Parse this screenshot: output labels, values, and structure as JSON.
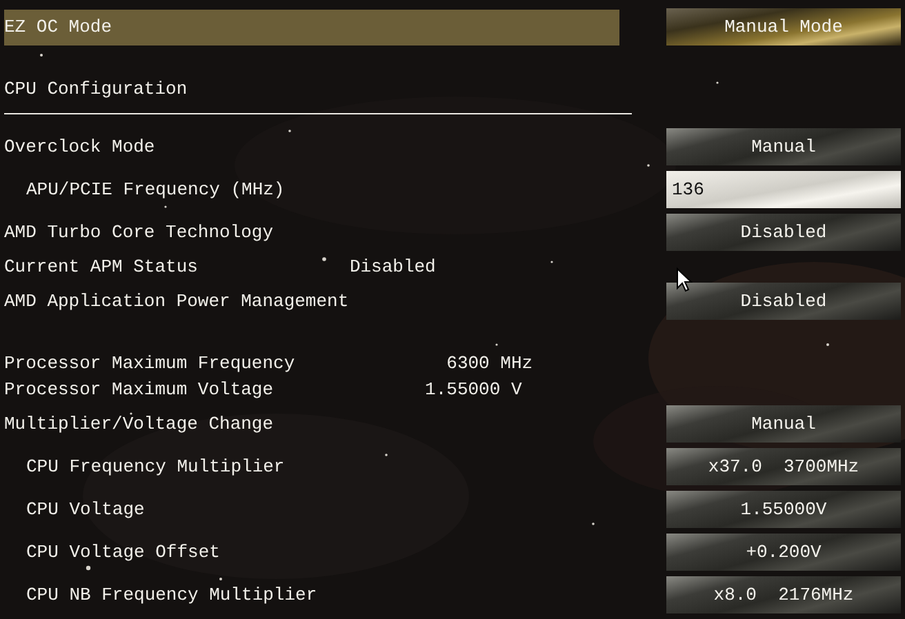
{
  "sections": [
    {
      "kind": "rows",
      "rows": [
        {
          "kind": "option",
          "label": "EZ OC Mode",
          "value": "Manual Mode",
          "selected": true
        }
      ]
    },
    {
      "kind": "heading",
      "title": "CPU Configuration"
    },
    {
      "kind": "rows",
      "rows": [
        {
          "kind": "option",
          "label": "Overclock Mode",
          "value": "Manual",
          "selected": false,
          "children": [
            {
              "kind": "input",
              "label": "APU/PCIE Frequency (MHz)",
              "value": "136",
              "selected": false
            }
          ]
        },
        {
          "kind": "option",
          "label": "AMD Turbo Core Technology",
          "value": "Disabled",
          "selected": false
        },
        {
          "kind": "info",
          "label": "Current APM Status",
          "value": "Disabled"
        },
        {
          "kind": "option",
          "label": "AMD Application Power Management",
          "value": "Disabled",
          "selected": false
        }
      ]
    },
    {
      "kind": "rows",
      "rows": [
        {
          "kind": "info",
          "label": "Processor Maximum Frequency",
          "value": "6300 MHz"
        },
        {
          "kind": "info",
          "label": "Processor Maximum Voltage",
          "value": "1.55000 V"
        },
        {
          "kind": "option",
          "label": "Multiplier/Voltage Change",
          "value": "Manual",
          "selected": false,
          "children": [
            {
              "kind": "option",
              "label": "CPU Frequency Multiplier",
              "value": "x37.0  3700MHz",
              "selected": false
            },
            {
              "kind": "option",
              "label": "CPU Voltage",
              "value": "1.55000V",
              "selected": false
            },
            {
              "kind": "option",
              "label": "CPU Voltage Offset",
              "value": "+0.200V",
              "selected": false
            },
            {
              "kind": "option",
              "label": "CPU NB Frequency Multiplier",
              "value": "x8.0  2176MHz",
              "selected": false
            }
          ]
        }
      ]
    }
  ]
}
